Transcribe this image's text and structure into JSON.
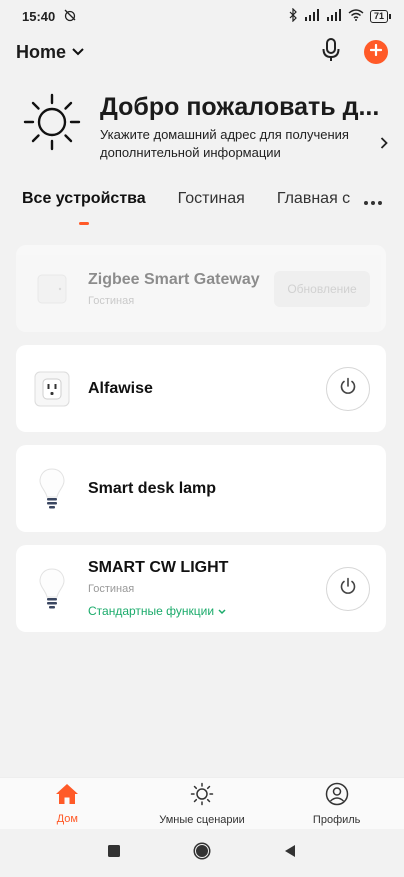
{
  "status": {
    "time": "15:40",
    "battery": "71"
  },
  "header": {
    "home_label": "Home"
  },
  "welcome": {
    "title": "Добро пожаловать д...",
    "subtitle": "Укажите домашний адрес для получения дополнительной информации"
  },
  "tabs": [
    {
      "label": "Все устройства",
      "active": true
    },
    {
      "label": "Гостиная",
      "active": false
    },
    {
      "label": "Главная с",
      "active": false
    }
  ],
  "devices": [
    {
      "name": "Zigbee Smart Gateway",
      "room": "Гостиная",
      "action": "Обновление",
      "icon": "gateway-icon",
      "offline": true
    },
    {
      "name": "Alfawise",
      "icon": "smart-plug-icon",
      "has_power": true
    },
    {
      "name": "Smart desk lamp",
      "icon": "bulb-icon"
    },
    {
      "name": "SMART CW LIGHT",
      "room": "Гостиная",
      "functions_label": "Стандартные функции",
      "icon": "bulb-icon",
      "has_power": true
    }
  ],
  "bottom_nav": [
    {
      "label": "Дом",
      "icon": "home-icon",
      "active": true
    },
    {
      "label": "Умные сценарии",
      "icon": "sun-icon",
      "active": false
    },
    {
      "label": "Профиль",
      "icon": "profile-icon",
      "active": false
    }
  ],
  "colors": {
    "accent": "#ff5a28",
    "function_green": "#1bab6b",
    "background": "#f2f2f2"
  }
}
